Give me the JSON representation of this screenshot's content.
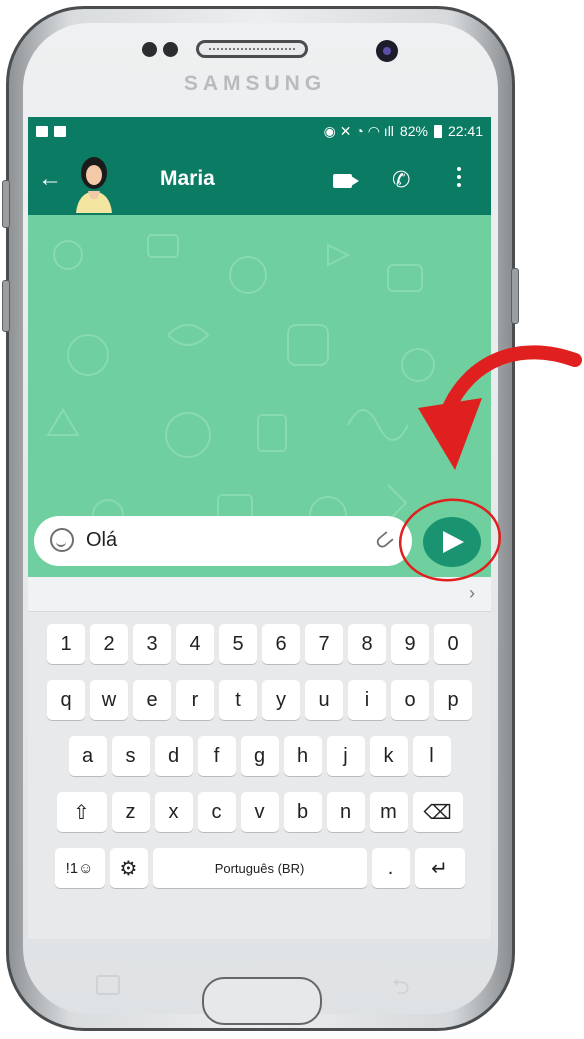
{
  "device": {
    "brand": "SAMSUNG"
  },
  "status_bar": {
    "battery": "82%",
    "time": "22:41"
  },
  "app_bar": {
    "back_icon": "arrow-left-icon",
    "contact_name": "Maria",
    "video_icon": "videocam-icon",
    "call_icon": "phone-icon",
    "menu_icon": "more-vert-icon"
  },
  "input": {
    "value": "Olá",
    "emoji_icon": "sticker-icon",
    "attach_icon": "paperclip-icon",
    "send_icon": "send-icon"
  },
  "keyboard": {
    "suggestion_chevron": "›",
    "rows": [
      [
        "1",
        "2",
        "3",
        "4",
        "5",
        "6",
        "7",
        "8",
        "9",
        "0"
      ],
      [
        "q",
        "w",
        "e",
        "r",
        "t",
        "y",
        "u",
        "i",
        "o",
        "p"
      ],
      [
        "a",
        "s",
        "d",
        "f",
        "g",
        "h",
        "j",
        "k",
        "l"
      ],
      [
        "⇧",
        "z",
        "x",
        "c",
        "v",
        "b",
        "n",
        "m",
        "⌫"
      ]
    ],
    "bottom": {
      "symbols": "!1☺",
      "settings_icon": "gear-icon",
      "space": "Português (BR)",
      "period": ".",
      "enter": "↵"
    }
  },
  "colors": {
    "app_green": "#0b7b63",
    "chat_bg": "#6fcf9e",
    "send_green": "#1a9470",
    "annotation_red": "#e0201e"
  }
}
